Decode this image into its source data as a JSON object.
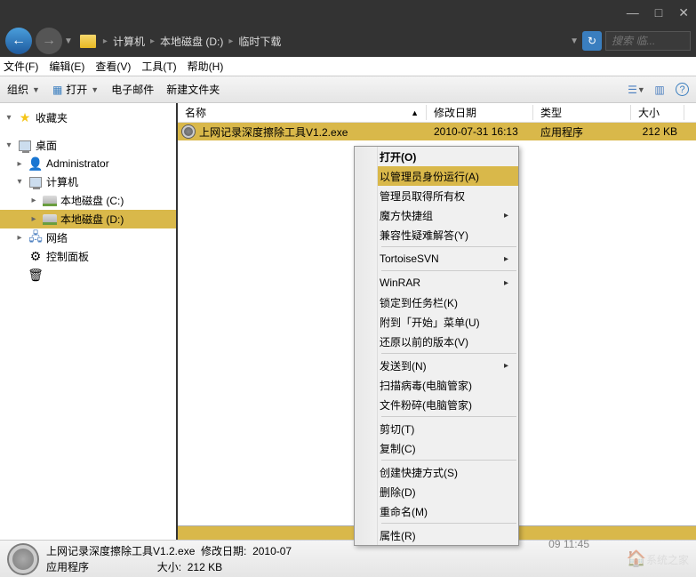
{
  "titlebar": {
    "min": "—",
    "max": "□",
    "close": "✕"
  },
  "breadcrumb": {
    "items": [
      "计算机",
      "本地磁盘 (D:)",
      "临时下载"
    ]
  },
  "search": {
    "placeholder": "搜索 临..."
  },
  "menubar": {
    "file": "文件(F)",
    "edit": "编辑(E)",
    "view": "查看(V)",
    "tools": "工具(T)",
    "help": "帮助(H)"
  },
  "toolbar": {
    "organize": "组织",
    "open": "打开",
    "email": "电子邮件",
    "new_folder": "新建文件夹"
  },
  "sidebar": {
    "favorites": "收藏夹",
    "desktop": "桌面",
    "administrator": "Administrator",
    "computer": "计算机",
    "disk_c": "本地磁盘 (C:)",
    "disk_d": "本地磁盘 (D:)",
    "network": "网络",
    "control_panel": "控制面板"
  },
  "columns": {
    "name": "名称",
    "date": "修改日期",
    "type": "类型",
    "size": "大小"
  },
  "files": [
    {
      "name": "上网记录深度擦除工具V1.2.exe",
      "date": "2010-07-31 16:13",
      "type": "应用程序",
      "size": "212 KB"
    }
  ],
  "statusbar": {
    "line1_name": "上网记录深度擦除工具V1.2.exe",
    "line1_date_label": "修改日期:",
    "line1_date": "2010-07",
    "line1_date_tail": "09 11:45",
    "line2_type": "应用程序",
    "line2_size_label": "大小:",
    "line2_size": "212 KB",
    "watermark": "系统之家"
  },
  "context": {
    "open": "打开(O)",
    "run_admin": "以管理员身份运行(A)",
    "take_ownership": "管理员取得所有权",
    "mofang": "魔方快捷组",
    "compat": "兼容性疑难解答(Y)",
    "tortoise": "TortoiseSVN",
    "winrar": "WinRAR",
    "pin_taskbar": "锁定到任务栏(K)",
    "pin_start": "附到「开始」菜单(U)",
    "restore_prev": "还原以前的版本(V)",
    "send_to": "发送到(N)",
    "scan_virus": "扫描病毒(电脑管家)",
    "shred": "文件粉碎(电脑管家)",
    "cut": "剪切(T)",
    "copy": "复制(C)",
    "shortcut": "创建快捷方式(S)",
    "delete": "删除(D)",
    "rename": "重命名(M)",
    "properties": "属性(R)"
  }
}
